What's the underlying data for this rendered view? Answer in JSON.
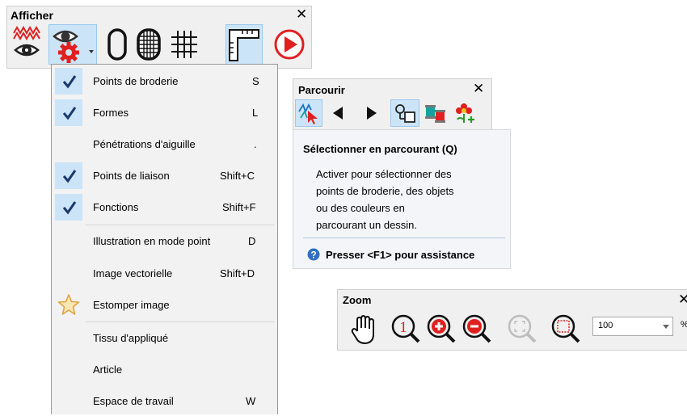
{
  "afficher": {
    "title": "Afficher",
    "close": "✕",
    "buttons": [
      "show-stitches-icon",
      "show-objects-icon",
      "show-outline-icon",
      "show-grid-fill-icon",
      "grid-icon",
      "ruler-guides-icon",
      "play-icon"
    ],
    "menu": {
      "items": [
        {
          "label": "Points de broderie",
          "shortcut": "S",
          "checked": true
        },
        {
          "label": "Formes",
          "shortcut": "L",
          "checked": true
        },
        {
          "label": "Pénétrations d'aiguille",
          "shortcut": ".",
          "checked": false
        },
        {
          "label": "Points de liaison",
          "shortcut": "Shift+C",
          "checked": true
        },
        {
          "label": "Fonctions",
          "shortcut": "Shift+F",
          "checked": true
        },
        {
          "label": "Illustration en mode point",
          "shortcut": "D",
          "checked": false
        },
        {
          "label": "Image vectorielle",
          "shortcut": "Shift+D",
          "checked": false
        },
        {
          "label": "Estomper image",
          "shortcut": "",
          "checked": false,
          "icon": "star-icon"
        },
        {
          "label": "Tissu d'appliqué",
          "shortcut": "",
          "checked": false
        },
        {
          "label": "Article",
          "shortcut": "",
          "checked": false
        },
        {
          "label": "Espace de travail",
          "shortcut": "W",
          "checked": false
        }
      ]
    }
  },
  "parcourir": {
    "title": "Parcourir",
    "close": "✕",
    "tooltip": {
      "title": "Sélectionner en parcourant (Q)",
      "lines": [
        "Activer pour sélectionner des",
        "points de broderie, des objets",
        "ou des couleurs en",
        "parcourant un dessin."
      ],
      "help": "Presser <F1> pour assistance"
    }
  },
  "zoom": {
    "title": "Zoom",
    "close": "✕",
    "value": "100",
    "unit": "%"
  },
  "colors": {
    "toolbar_bg": "#f0f0f0",
    "selected_bg": "#cce4f7",
    "selected_border": "#99c9ef",
    "check": "#1a3a6b",
    "red": "#e02020"
  }
}
